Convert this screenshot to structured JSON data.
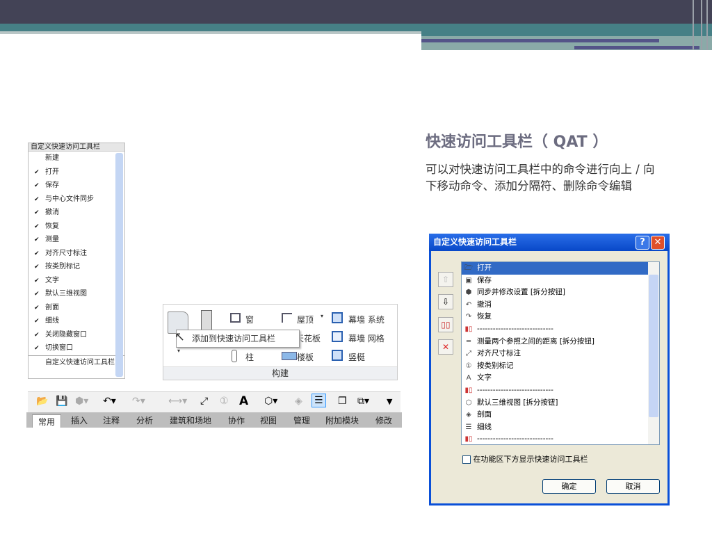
{
  "slide": {
    "title": "快速访问工具栏（ QAT ）",
    "description": "可以对快速访问工具栏中的命令进行向上 / 向下移动命令、添加分隔符、删除命令编辑"
  },
  "menu": {
    "header": "自定义快速访问工具栏",
    "items": [
      {
        "label": "新建",
        "checked": false
      },
      {
        "label": "打开",
        "checked": true
      },
      {
        "label": "保存",
        "checked": true
      },
      {
        "label": "与中心文件同步",
        "checked": true
      },
      {
        "label": "撤消",
        "checked": true
      },
      {
        "label": "恢复",
        "checked": true
      },
      {
        "label": "测量",
        "checked": true
      },
      {
        "label": "对齐尺寸标注",
        "checked": true
      },
      {
        "label": "按类别标记",
        "checked": true
      },
      {
        "label": "文字",
        "checked": true
      },
      {
        "label": "默认三维视图",
        "checked": true
      },
      {
        "label": "剖面",
        "checked": true
      },
      {
        "label": "细线",
        "checked": true
      },
      {
        "label": "关闭隐藏窗口",
        "checked": true
      },
      {
        "label": "切换窗口",
        "checked": true
      }
    ],
    "footer": "自定义快速访问工具栏",
    "check": "✔"
  },
  "ribbon": {
    "window": "窗",
    "roof": "屋顶",
    "curtain_system": "幕墙 系统",
    "ceiling": "天花板",
    "curtain_grid": "幕墙 网格",
    "column": "柱",
    "floor": "楼板",
    "mullion": "竖梃",
    "panel": "构建",
    "tooltip": "添加到快速访问工具栏"
  },
  "tabs": [
    "常用",
    "插入",
    "注释",
    "分析",
    "建筑和场地",
    "协作",
    "视图",
    "管理",
    "附加模块",
    "修改"
  ],
  "dialog": {
    "title": "自定义快速访问工具栏",
    "help": "?",
    "close": "✕",
    "items": [
      {
        "icon": "folder-icon",
        "label": "打开"
      },
      {
        "icon": "save-icon",
        "label": "保存"
      },
      {
        "icon": "sync-icon",
        "label": "同步并修改设置 [拆分按钮]"
      },
      {
        "icon": "undo-icon",
        "label": "撤消"
      },
      {
        "icon": "redo-icon",
        "label": "恢复"
      },
      {
        "icon": "separator-icon",
        "label": "-----------------------------"
      },
      {
        "icon": "measure-icon",
        "label": "测量两个参照之间的距离 [拆分按钮]"
      },
      {
        "icon": "aligned-dimension-icon",
        "label": "对齐尺寸标注"
      },
      {
        "icon": "tag-icon",
        "label": "按类别标记"
      },
      {
        "icon": "text-icon",
        "label": "文字"
      },
      {
        "icon": "separator-icon",
        "label": "-----------------------------"
      },
      {
        "icon": "3d-view-icon",
        "label": "默认三维视图 [拆分按钮]"
      },
      {
        "icon": "section-icon",
        "label": "剖面"
      },
      {
        "icon": "thin-lines-icon",
        "label": "细线"
      },
      {
        "icon": "separator-icon",
        "label": "-----------------------------"
      }
    ],
    "checkbox": "在功能区下方显示快速访问工具栏",
    "ok": "确定",
    "cancel": "取消"
  }
}
